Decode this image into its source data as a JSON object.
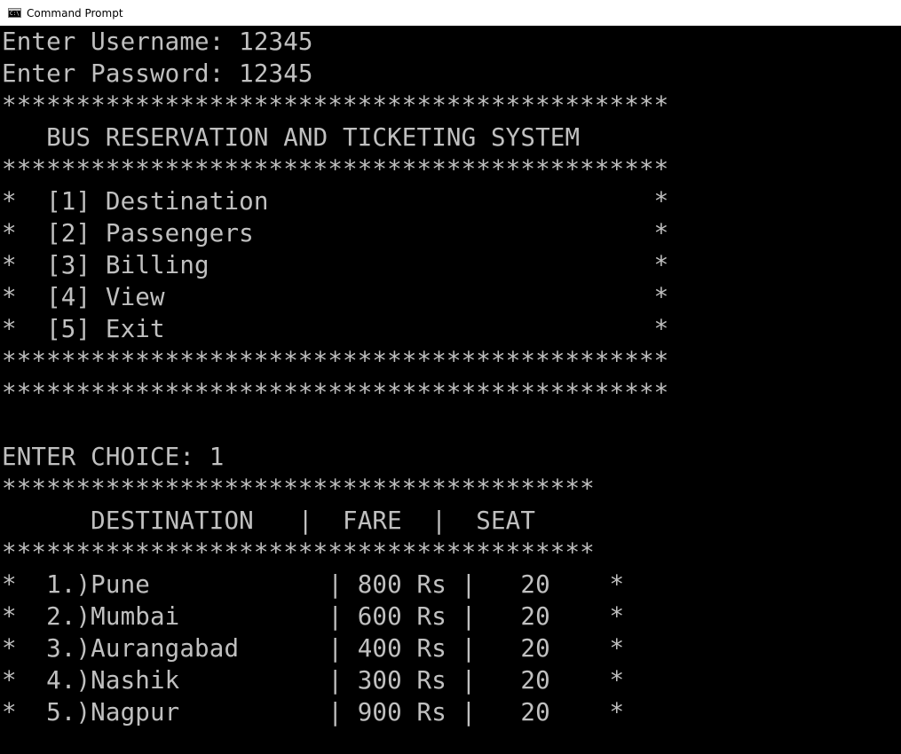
{
  "window": {
    "title": "Command Prompt",
    "icon": "cmd-console-icon"
  },
  "console": {
    "lines": [
      "Enter Username: 12345",
      "Enter Password: 12345",
      "*********************************************",
      "   BUS RESERVATION AND TICKETING SYSTEM",
      "*********************************************",
      "*  [1] Destination                          *",
      "*  [2] Passengers                           *",
      "*  [3] Billing                              *",
      "*  [4] View                                 *",
      "*  [5] Exit                                 *",
      "*********************************************",
      "*********************************************",
      "",
      "",
      "ENTER CHOICE: 1",
      "****************************************",
      "      DESTINATION   |  FARE  |  SEAT",
      "****************************************",
      "*  1.)Pune            | 800 Rs |   20    *",
      "*  2.)Mumbai          | 600 Rs |   20    *",
      "*  3.)Aurangabad      | 400 Rs |   20    *",
      "*  4.)Nashik          | 300 Rs |   20    *",
      "*  5.)Nagpur          | 900 Rs |   20    *"
    ]
  }
}
